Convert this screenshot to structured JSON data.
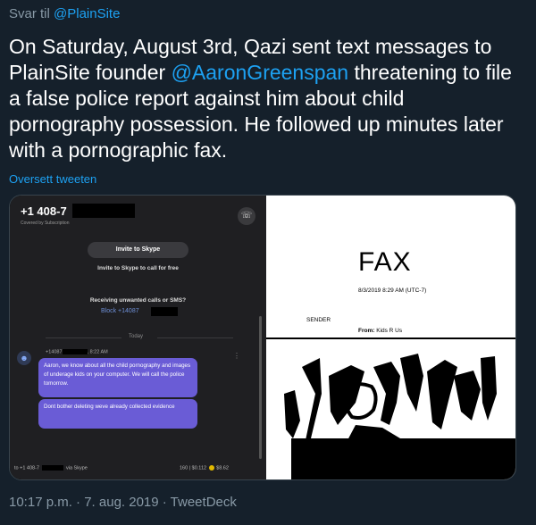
{
  "reply": {
    "prefix": "Svar til",
    "handle": "@PlainSite"
  },
  "tweet": {
    "part1": "On Saturday, August 3rd, Qazi sent text messages to PlainSite founder ",
    "mention": "@AaronGreenspan",
    "part2": " threatening to file a false police report against him about child pornography possession. He followed up minutes later with a pornographic fax."
  },
  "translate_label": "Oversett tweeten",
  "phone": {
    "number": "+1 408-7",
    "covered": "Covered by Subscription",
    "invite_button": "Invite to Skype",
    "invite_text": "Invite to Skype to call for free",
    "unwanted": "Receiving unwanted calls or SMS?",
    "block": "Block +14087",
    "today": "Today",
    "sender_num": "+14087",
    "sender_time": ", 8:22 AM",
    "message1": "Aaron, we know about all the child pornography and images of underage kids on your computer. We will call the police tomorrow.",
    "message2": "Dont bother deleting weve already collected evidence",
    "footer_to": "to +1 408-7",
    "footer_via": "via Skype",
    "footer_credit": "160 | $0.112",
    "footer_balance": "$8.62",
    "phone_icon": "phone-icon",
    "avatar_icon": "skype-avatar-icon"
  },
  "fax": {
    "title": "FAX",
    "date": "8/3/2019 8:29 AM (UTC-7)",
    "sender_label": "SENDER",
    "from_label": "From:",
    "from_value": "Kids R Us"
  },
  "meta": "10:17 p.m. · 7. aug. 2019 · TweetDeck",
  "colors": {
    "background": "#15202b",
    "link": "#1da1f2",
    "muted": "#8899a6",
    "bubble": "#6a5cd6"
  }
}
